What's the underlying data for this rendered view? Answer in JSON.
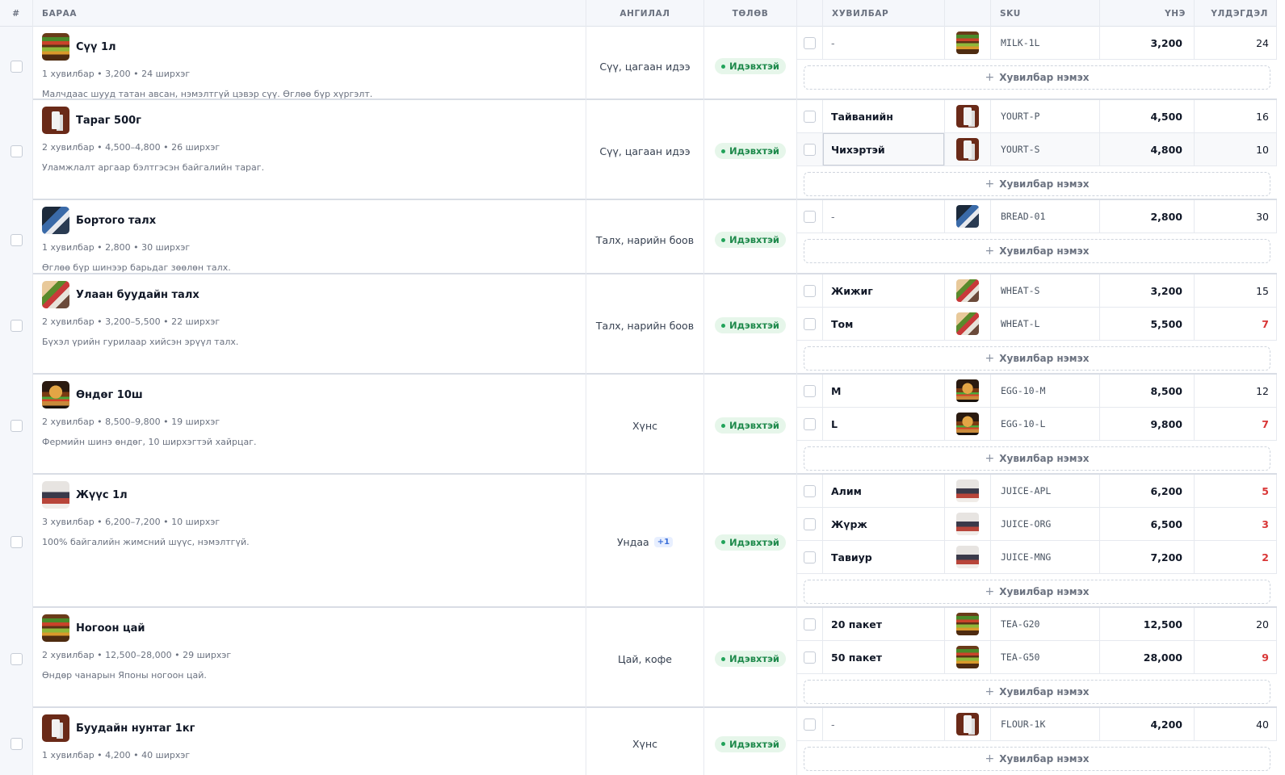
{
  "header": {
    "hash": "#",
    "product": "БАРАА",
    "category": "АНГИЛАЛ",
    "status": "ТӨЛӨВ",
    "variant": "ХУВИЛБАР",
    "sku": "SKU",
    "price": "ҮНЭ",
    "stock": "ҮЛДЭГДЭЛ"
  },
  "add_variant_label": "Хувилбар нэмэх",
  "products": [
    {
      "name": "Сүү 1л",
      "thumb": "shelf",
      "meta": "1 хувилбар • 3,200 • 24 ширхэг",
      "desc": "Малчдаас шууд татан авсан, нэмэлтгүй цэвэр сүү. Өглөө бүр хүргэлт.",
      "category": "Сүү, цагаан идээ",
      "more": "",
      "status": "Идэвхтэй",
      "height": 91,
      "variants": [
        {
          "name": "-",
          "sku": "MILK-1L",
          "price": "3,200",
          "stock": "24",
          "low": false
        }
      ]
    },
    {
      "name": "Тараг 500г",
      "thumb": "milk",
      "meta": "2 хувилбар • 4,500–4,800 • 26 ширхэг",
      "desc": "Уламжлалт аргаар бэлтгэсэн байгалийн тараг.",
      "category": "Сүү, цагаан идээ",
      "more": "",
      "status": "Идэвхтэй",
      "height": 124,
      "variants": [
        {
          "name": "Тайванийн",
          "sku": "YOURT-P",
          "price": "4,500",
          "stock": "16",
          "low": false
        },
        {
          "name": "Чихэртэй",
          "sku": "YOURT-S",
          "price": "4,800",
          "stock": "10",
          "low": false,
          "focused": true
        }
      ]
    },
    {
      "name": "Бортого талх",
      "thumb": "bread",
      "meta": "1 хувилбар • 2,800 • 30 ширхэг",
      "desc": "Өглөө бүр шинээр барьдаг зөөлөн талх.",
      "category": "Талх, нарийн боов",
      "more": "",
      "status": "Идэвхтэй",
      "height": 92,
      "variants": [
        {
          "name": "-",
          "sku": "BREAD-01",
          "price": "2,800",
          "stock": "30",
          "low": false
        }
      ]
    },
    {
      "name": "Улаан буудайн талх",
      "thumb": "wheat",
      "meta": "2 хувилбар • 3,200–5,500 • 22 ширхэг",
      "desc": "Бүхэл үрийн гурилаар хийсэн эрүүл талх.",
      "category": "Талх, нарийн боов",
      "more": "",
      "status": "Идэвхтэй",
      "height": 124,
      "variants": [
        {
          "name": "Жижиг",
          "sku": "WHEAT-S",
          "price": "3,200",
          "stock": "15",
          "low": false
        },
        {
          "name": "Том",
          "sku": "WHEAT-L",
          "price": "5,500",
          "stock": "7",
          "low": true
        }
      ]
    },
    {
      "name": "Өндөг 10ш",
      "thumb": "burger",
      "meta": "2 хувилбар • 8,500–9,800 • 19 ширхэг",
      "desc": "Фермийн шинэ өндөг, 10 ширхэгтэй хайрцаг.",
      "category": "Хүнс",
      "more": "",
      "status": "Идэвхтэй",
      "height": 124,
      "variants": [
        {
          "name": "M",
          "sku": "EGG-10-M",
          "price": "8,500",
          "stock": "12",
          "low": false
        },
        {
          "name": "L",
          "sku": "EGG-10-L",
          "price": "9,800",
          "stock": "7",
          "low": true
        }
      ]
    },
    {
      "name": "Жүүс 1л",
      "thumb": "people",
      "meta": "3 хувилбар • 6,200–7,200 • 10 ширхэг",
      "desc": "100% байгалийн жимсний шүүс, нэмэлтгүй.",
      "category": "Ундаа",
      "more": "+1",
      "status": "Идэвхтэй",
      "height": 165,
      "variants": [
        {
          "name": "Алим",
          "sku": "JUICE-APL",
          "price": "6,200",
          "stock": "5",
          "low": true
        },
        {
          "name": "Жүрж",
          "sku": "JUICE-ORG",
          "price": "6,500",
          "stock": "3",
          "low": true
        },
        {
          "name": "Тавиур",
          "sku": "JUICE-MNG",
          "price": "7,200",
          "stock": "2",
          "low": true
        }
      ]
    },
    {
      "name": "Ногоон цай",
      "thumb": "shelf",
      "meta": "2 хувилбар • 12,500–28,000 • 29 ширхэг",
      "desc": "Өндөр чанарын Японы ногоон цай.",
      "category": "Цай, кофе",
      "more": "",
      "status": "Идэвхтэй",
      "height": 124,
      "variants": [
        {
          "name": "20 пакет",
          "sku": "TEA-G20",
          "price": "12,500",
          "stock": "20",
          "low": false
        },
        {
          "name": "50 пакет",
          "sku": "TEA-G50",
          "price": "28,000",
          "stock": "9",
          "low": true
        }
      ]
    },
    {
      "name": "Буудайн нунтаг 1кг",
      "thumb": "milk",
      "meta": "1 хувилбар • 4,200 • 40 ширхэг",
      "desc": "",
      "category": "Хүнс",
      "more": "",
      "status": "Идэвхтэй",
      "height": 91,
      "variants": [
        {
          "name": "-",
          "sku": "FLOUR-1K",
          "price": "4,200",
          "stock": "40",
          "low": false
        }
      ]
    }
  ]
}
